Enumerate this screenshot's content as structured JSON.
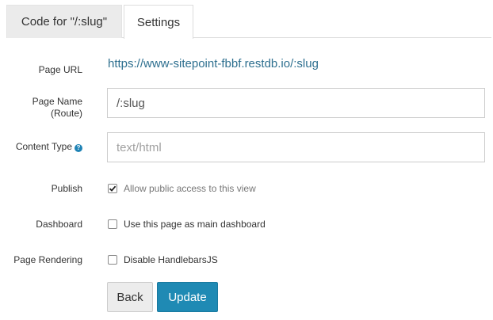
{
  "tabs": [
    {
      "label": "Code for \"/:slug\"",
      "active": false
    },
    {
      "label": "Settings",
      "active": true
    }
  ],
  "form": {
    "page_url": {
      "label": "Page URL",
      "value": "https://www-sitepoint-fbbf.restdb.io/:slug"
    },
    "page_name": {
      "label_line1": "Page Name",
      "label_line2": "(Route)",
      "value": "/:slug"
    },
    "content_type": {
      "label": "Content Type",
      "help_icon": "question-circle-icon",
      "placeholder": "text/html"
    },
    "publish": {
      "label": "Publish",
      "checked": true,
      "checkbox_label": "Allow public access to this view"
    },
    "dashboard": {
      "label": "Dashboard",
      "checked": false,
      "checkbox_label": "Use this page as main dashboard"
    },
    "page_rendering": {
      "label": "Page Rendering",
      "checked": false,
      "checkbox_label": "Disable HandlebarsJS"
    }
  },
  "buttons": {
    "back_label": "Back",
    "update_label": "Update"
  },
  "colors": {
    "accent": "#1f8ab4",
    "link": "#2d6f8f"
  }
}
